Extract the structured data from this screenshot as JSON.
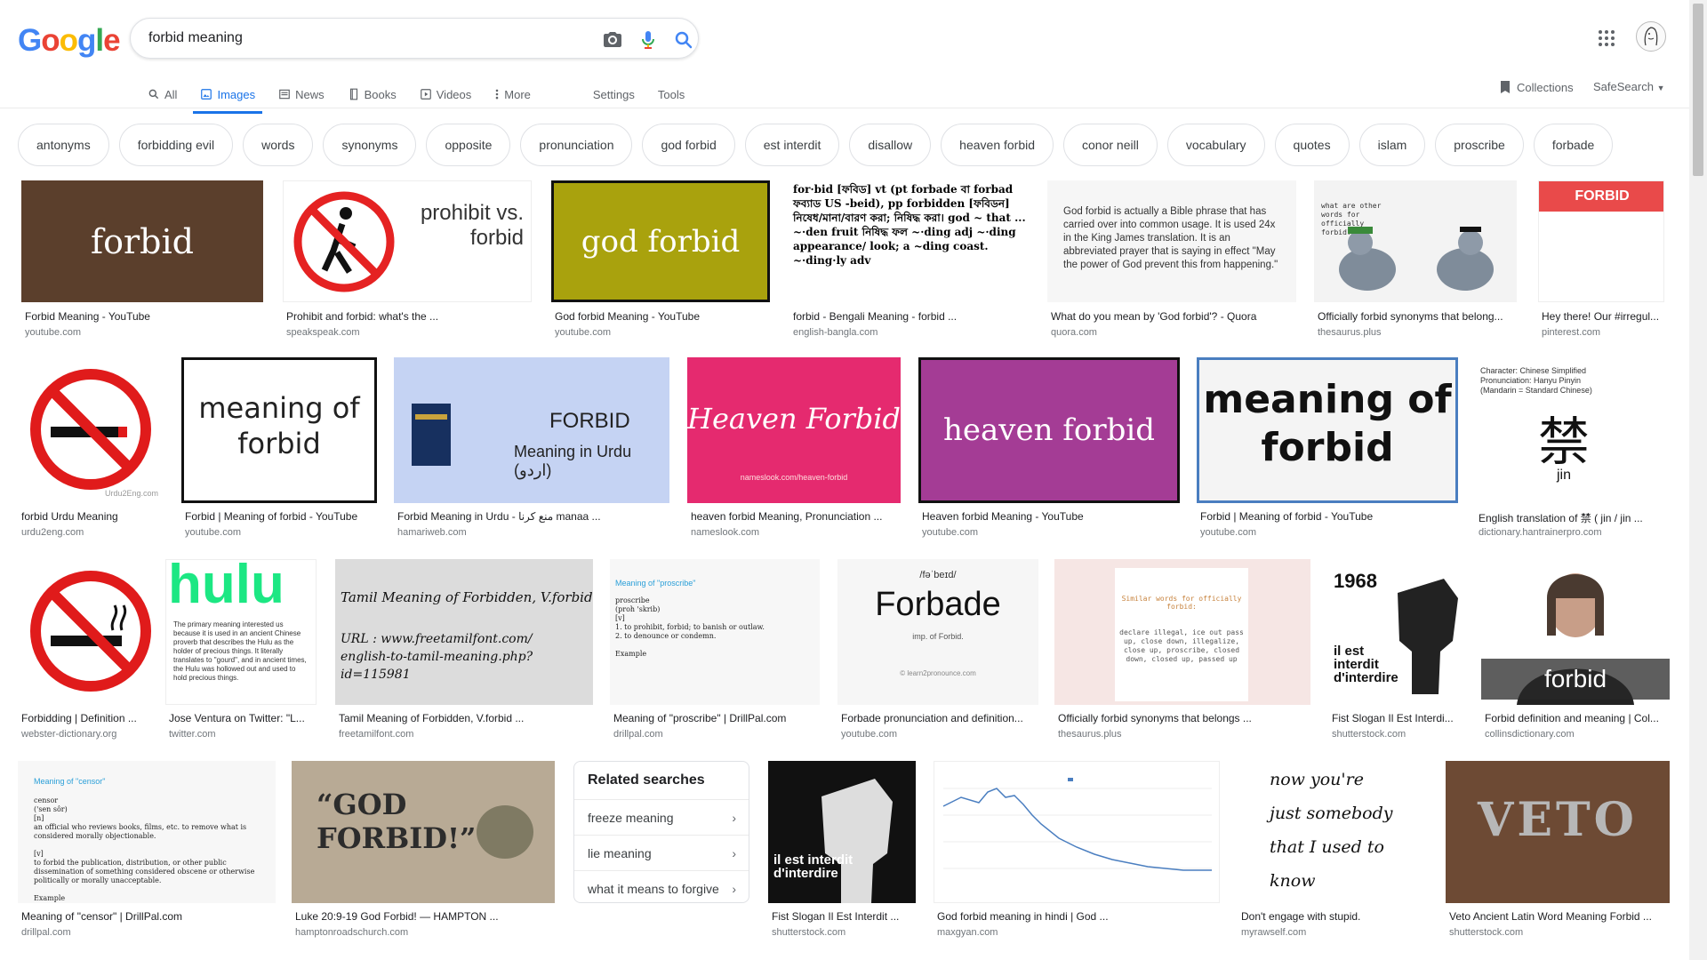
{
  "logo": [
    "G",
    "o",
    "o",
    "g",
    "l",
    "e"
  ],
  "search": {
    "value": "forbid meaning"
  },
  "tabs": [
    {
      "label": "All",
      "icon": "search-icon"
    },
    {
      "label": "Images",
      "icon": "image-icon",
      "active": true
    },
    {
      "label": "News",
      "icon": "news-icon"
    },
    {
      "label": "Books",
      "icon": "book-icon"
    },
    {
      "label": "Videos",
      "icon": "video-icon"
    },
    {
      "label": "More",
      "icon": "more-vert-icon"
    }
  ],
  "settings_label": "Settings",
  "tools_label": "Tools",
  "collections_label": "Collections",
  "safesearch_label": "SafeSearch",
  "chips": [
    "antonyms",
    "forbidding evil",
    "words",
    "synonyms",
    "opposite",
    "pronunciation",
    "god forbid",
    "est interdit",
    "disallow",
    "heaven forbid",
    "conor neill",
    "vocabulary",
    "quotes",
    "islam",
    "proscribe",
    "forbade"
  ],
  "results": [
    {
      "caption": "Forbid Meaning - YouTube",
      "source": "youtube.com",
      "thumb_text": "forbid"
    },
    {
      "caption": "Prohibit and forbid: what's the ...",
      "source": "speakspeak.com",
      "thumb_text": "prohibit vs. forbid"
    },
    {
      "caption": "God forbid Meaning - YouTube",
      "source": "youtube.com",
      "thumb_text": "god forbid"
    },
    {
      "caption": "forbid - Bengali Meaning - forbid ...",
      "source": "english-bangla.com",
      "thumb_text": "for·bid [ফবিড] vt (pt forbade বা forbad ফব্যাড US -beid), pp forbidden [ফবিডন] নিষেধ/মানা/বারণ করা; নিষিদ্ধ করা। god ~ that ... ~·den fruit নিষিদ্ধ ফল ~·ding adj ~·ding appearance/ look; a ~ding coast. ~·ding·ly adv"
    },
    {
      "caption": "What do you mean by 'God forbid'? - Quora",
      "source": "quora.com",
      "thumb_text": "God forbid is actually a Bible phrase that has carried over into common usage. It is used 24x in the King James translation. It is an abbreviated prayer that is saying in effect \"May the power of God prevent this from happening.\""
    },
    {
      "caption": "Officially forbid synonyms that belong...",
      "source": "thesaurus.plus",
      "thumb_text": "what are other words for officially forbid?"
    },
    {
      "caption": "Hey there! Our #irregul...",
      "source": "pinterest.com",
      "thumb_text": "FORBID"
    },
    {
      "caption": "forbid Urdu Meaning",
      "source": "urdu2eng.com",
      "thumb_text": "Urdu2Eng.com"
    },
    {
      "caption": "Forbid | Meaning of forbid - YouTube",
      "source": "youtube.com",
      "thumb_text": "meaning of forbid"
    },
    {
      "caption": "Forbid Meaning in Urdu - منع کرنا manaa ...",
      "source": "hamariweb.com",
      "thumb_text": "FORBID"
    },
    {
      "caption": "heaven forbid Meaning, Pronunciation ...",
      "source": "nameslook.com",
      "thumb_text": "Heaven Forbid"
    },
    {
      "caption": "Heaven forbid Meaning - YouTube",
      "source": "youtube.com",
      "thumb_text": "heaven forbid"
    },
    {
      "caption": "Forbid | Meaning of forbid - YouTube",
      "source": "youtube.com",
      "thumb_text": "meaning of forbid"
    },
    {
      "caption": "English translation of 禁 ( jin / jin ...",
      "source": "dictionary.hantrainerpro.com",
      "thumb_text": "禁"
    },
    {
      "caption": "Forbidding | Definition ...",
      "source": "webster-dictionary.org",
      "thumb_text": ""
    },
    {
      "caption": "Jose Ventura on Twitter: \"L...",
      "source": "twitter.com",
      "thumb_text": "hulu"
    },
    {
      "caption": "Tamil Meaning of Forbidden, V.forbid ...",
      "source": "freetamilfont.com",
      "thumb_text": "Tamil Meaning of Forbidden, V.forbid"
    },
    {
      "caption": "Meaning of \"proscribe\" | DrillPal.com",
      "source": "drillpal.com",
      "thumb_text": "Meaning of \"proscribe\""
    },
    {
      "caption": "Forbade pronunciation and definition...",
      "source": "youtube.com",
      "thumb_text": "Forbade"
    },
    {
      "caption": "Officially forbid synonyms that belongs ...",
      "source": "thesaurus.plus",
      "thumb_text": "Similar words for officially forbid:"
    },
    {
      "caption": "Fist Slogan Il Est Interdi...",
      "source": "shutterstock.com",
      "thumb_text": "1968"
    },
    {
      "caption": "Forbid definition and meaning | Col...",
      "source": "collinsdictionary.com",
      "thumb_text": "forbid"
    },
    {
      "caption": "Meaning of \"censor\" | DrillPal.com",
      "source": "drillpal.com",
      "thumb_text": "Meaning of \"censor\""
    },
    {
      "caption": "Luke 20:9-19 God Forbid! — HAMPTON ...",
      "source": "hamptonroadschurch.com",
      "thumb_text": "“GOD FORBID!”"
    },
    {
      "caption": "Fist Slogan Il Est Interdit ...",
      "source": "shutterstock.com",
      "thumb_text": "il est interdit d'interdire"
    },
    {
      "caption": "God forbid meaning in hindi | God ...",
      "source": "maxgyan.com",
      "thumb_text": ""
    },
    {
      "caption": "Don't engage with stupid.",
      "source": "myrawself.com",
      "thumb_text": "now you're just somebody that I used to know"
    },
    {
      "caption": "Veto Ancient Latin Word Meaning Forbid ...",
      "source": "shutterstock.com",
      "thumb_text": "VETO"
    }
  ],
  "related": {
    "title": "Related searches",
    "items": [
      "freeze meaning",
      "lie meaning",
      "what it means to forgive"
    ]
  },
  "colors": {
    "accent": "#1a73e8",
    "chip_border": "#dfe1e5"
  }
}
